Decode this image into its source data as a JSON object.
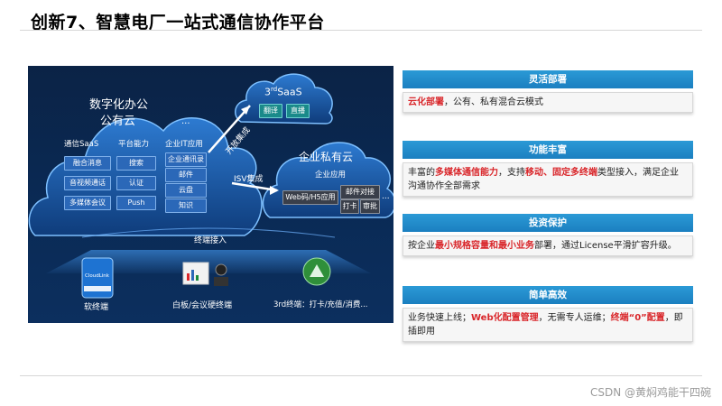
{
  "page": {
    "title": "创新7、智慧电厂一站式通信协作平台",
    "footer": "CSDN @黄焖鸡能干四碗"
  },
  "diagram": {
    "public_cloud": {
      "title_line1": "数字化办公",
      "title_line2": "公有云",
      "ellipsis": "...",
      "col1_label": "通信SaaS",
      "col2_label": "平台能力",
      "col3_label": "企业IT应用",
      "col1_items": [
        "融合消息",
        "音视频通话",
        "多媒体会议"
      ],
      "col2_items": [
        "搜索",
        "认证",
        "Push"
      ],
      "col3_items": [
        "企业通讯录",
        "邮件",
        "云盘",
        "知识"
      ]
    },
    "saas_cloud": {
      "title_sup": "rd",
      "title_pre": "3",
      "title_post": "SaaS",
      "items": [
        "翻译",
        "直播"
      ]
    },
    "private_cloud": {
      "title": "企业私有云",
      "subtitle": "企业应用",
      "app1": "Web码/H5应用",
      "app2": "邮件对接",
      "app3": "打卡",
      "app4": "审批",
      "ellipsis": "..."
    },
    "arrows": {
      "open_integration": "开放集成",
      "isv_integration": "ISV集成"
    },
    "terminal_access": "终端接入",
    "endpoints": {
      "soft": "软终端",
      "soft_brand": "CloudLink",
      "meeting": "白板/会议硬终端",
      "third": "3rd终端：打卡/充值/消费..."
    }
  },
  "panel": [
    {
      "header": "灵活部署",
      "segments": [
        {
          "text": "云化部署",
          "hl": true
        },
        {
          "text": "，公有、私有混合云模式",
          "hl": false
        }
      ]
    },
    {
      "header": "功能丰富",
      "segments": [
        {
          "text": "丰富的",
          "hl": false
        },
        {
          "text": "多媒体通信能力",
          "hl": true
        },
        {
          "text": "，支持",
          "hl": false
        },
        {
          "text": "移动、固定多终端",
          "hl": true
        },
        {
          "text": "类型接入，满足企业沟通协作全部需求",
          "hl": false
        }
      ]
    },
    {
      "header": "投资保护",
      "segments": [
        {
          "text": "按企业",
          "hl": false
        },
        {
          "text": "最小规格容量和最小业务",
          "hl": true
        },
        {
          "text": "部署，通过License平滑扩容升级。",
          "hl": false
        }
      ]
    },
    {
      "header": "简单高效",
      "segments": [
        {
          "text": "业务快速上线；",
          "hl": false
        },
        {
          "text": "Web化配置管理",
          "hl": true
        },
        {
          "text": "，无需专人运维；",
          "hl": false
        },
        {
          "text": "终端“0”配置",
          "hl": true
        },
        {
          "text": "，即插即用",
          "hl": false
        }
      ]
    }
  ]
}
